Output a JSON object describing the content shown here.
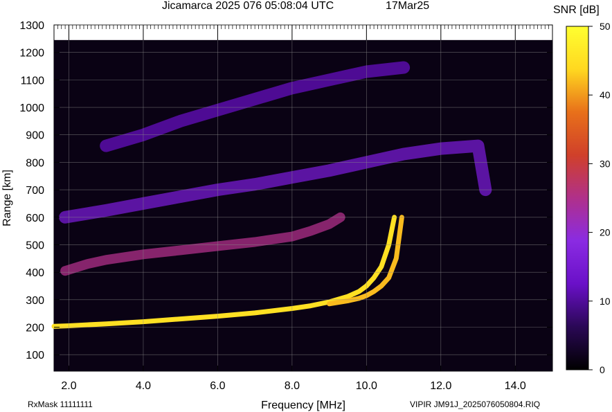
{
  "header": {
    "title": "Jicamarca 2025 076 05:08:04 UTC",
    "date": "17Mar25"
  },
  "footer": {
    "rxmask": "RxMask 11111111",
    "filename": "VIPIR  JM91J_2025076050804.RIQ"
  },
  "colorbar": {
    "title": "SNR [dB]",
    "min": 0,
    "max": 50,
    "ticks": [
      0,
      10,
      20,
      30,
      40,
      50
    ],
    "colors": [
      "#000000",
      "#2a0855",
      "#6a10c8",
      "#8a2be2",
      "#b0308a",
      "#d0402a",
      "#e8701a",
      "#ffd820",
      "#ffff30"
    ]
  },
  "chart_data": {
    "type": "heatmap",
    "title": "Jicamarca 2025 076 05:08:04 UTC",
    "xlabel": "Frequency [MHz]",
    "ylabel": "Range [km]",
    "xlim": [
      1.6,
      15.0
    ],
    "ylim": [
      40,
      1300
    ],
    "xticks": [
      2.0,
      4.0,
      6.0,
      8.0,
      10.0,
      12.0,
      14.0
    ],
    "xtick_labels": [
      "2.0",
      "4.0",
      "6.0",
      "8.0",
      "10.0",
      "12.0",
      "14.0"
    ],
    "yticks": [
      100,
      200,
      300,
      400,
      500,
      600,
      700,
      800,
      900,
      1000,
      1100,
      1200,
      1300
    ],
    "grid": true,
    "data_max_range_km": 1245,
    "series": [
      {
        "name": "",
        "snr_db": 45,
        "x": [
          1.6,
          2.0,
          3.0,
          4.0,
          5.0,
          6.0,
          7.0,
          8.0,
          8.5,
          9.0,
          9.5,
          9.8,
          10.0,
          10.2,
          10.4,
          10.6,
          10.75
        ],
        "y": [
          203,
          205,
          212,
          220,
          230,
          240,
          252,
          268,
          278,
          292,
          312,
          330,
          350,
          380,
          420,
          500,
          600
        ]
      },
      {
        "name": "",
        "snr_db": 42,
        "x": [
          9.0,
          9.5,
          9.8,
          10.0,
          10.2,
          10.4,
          10.6,
          10.8,
          10.95
        ],
        "y": [
          285,
          296,
          305,
          315,
          330,
          350,
          380,
          450,
          600
        ]
      },
      {
        "name": "",
        "snr_db": 25,
        "x": [
          1.9,
          2.5,
          3.0,
          4.0,
          5.0,
          6.0,
          7.0,
          8.0,
          8.5,
          9.0,
          9.3
        ],
        "y": [
          405,
          430,
          445,
          465,
          480,
          495,
          510,
          530,
          550,
          575,
          600
        ]
      },
      {
        "name": "",
        "snr_db": 15,
        "x": [
          1.9,
          3.0,
          4.0,
          5.0,
          6.0,
          7.0,
          8.0,
          9.0,
          10.0,
          11.0,
          12.0,
          13.0,
          13.2
        ],
        "y": [
          600,
          625,
          650,
          675,
          700,
          720,
          745,
          770,
          800,
          830,
          850,
          860,
          700
        ]
      },
      {
        "name": "",
        "snr_db": 12,
        "x": [
          3.0,
          4.0,
          5.0,
          6.0,
          7.0,
          8.0,
          9.0,
          10.0,
          11.0
        ],
        "y": [
          860,
          900,
          950,
          990,
          1030,
          1070,
          1100,
          1130,
          1145
        ]
      }
    ]
  }
}
